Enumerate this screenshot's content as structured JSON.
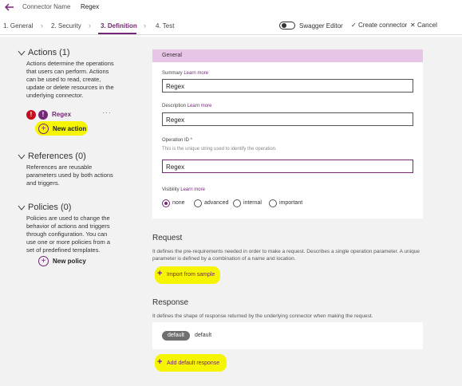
{
  "header": {
    "connector_name_label": "Connector Name",
    "connector_name_value": "Regex"
  },
  "steps": [
    {
      "label": "1. General"
    },
    {
      "label": "2. Security"
    },
    {
      "label": "3. Definition",
      "active": true
    },
    {
      "label": "4. Test"
    }
  ],
  "toolbar": {
    "swagger_label": "Swagger Editor",
    "swagger_enabled": false,
    "create_label": "Create connector",
    "cancel_label": "Cancel"
  },
  "sidebar": {
    "actions": {
      "title": "Actions (1)",
      "description": "Actions determine the operations that users can perform. Actions can be used to read, create, update or delete resources in the underlying connector.",
      "items": [
        {
          "name": "Regex",
          "warning_icon": "!",
          "info_icon": "!"
        }
      ],
      "more_label": "···",
      "add_label": "New action"
    },
    "references": {
      "title": "References (0)",
      "description": "References are reusable parameters used by both actions and triggers."
    },
    "policies": {
      "title": "Policies (0)",
      "description": "Policies are used to change the behavior of actions and triggers through configuration. You can use one or more policies from a set of predefined templates.",
      "add_label": "New policy"
    }
  },
  "general": {
    "header": "General",
    "summary": {
      "label": "Summary",
      "learn_more": "Learn more",
      "value": "Regex"
    },
    "description": {
      "label": "Description",
      "learn_more": "Learn more",
      "value": "Regex"
    },
    "operation_id": {
      "label": "Operation ID *",
      "hint": "This is the unique string used to identify the operation.",
      "value": "Regex"
    },
    "visibility": {
      "label": "Visibility",
      "learn_more": "Learn more",
      "options": [
        "none",
        "advanced",
        "internal",
        "important"
      ],
      "selected": "none"
    }
  },
  "request": {
    "title": "Request",
    "description": "It defines the pre-requirements needed in order to make a request. Describes a single operation parameter. A unique parameter is defined by a combination of a name and location.",
    "import_label": "Import from sample"
  },
  "response": {
    "title": "Response",
    "description": "It defines the shape of response returned by the underlying connector when making the request.",
    "badge": "default",
    "default_label": "default",
    "add_label": "Add default response"
  },
  "colors": {
    "accent": "#742774",
    "header_band": "#e6c5e6",
    "highlight": "#f5f500",
    "error": "#c50f1f"
  }
}
